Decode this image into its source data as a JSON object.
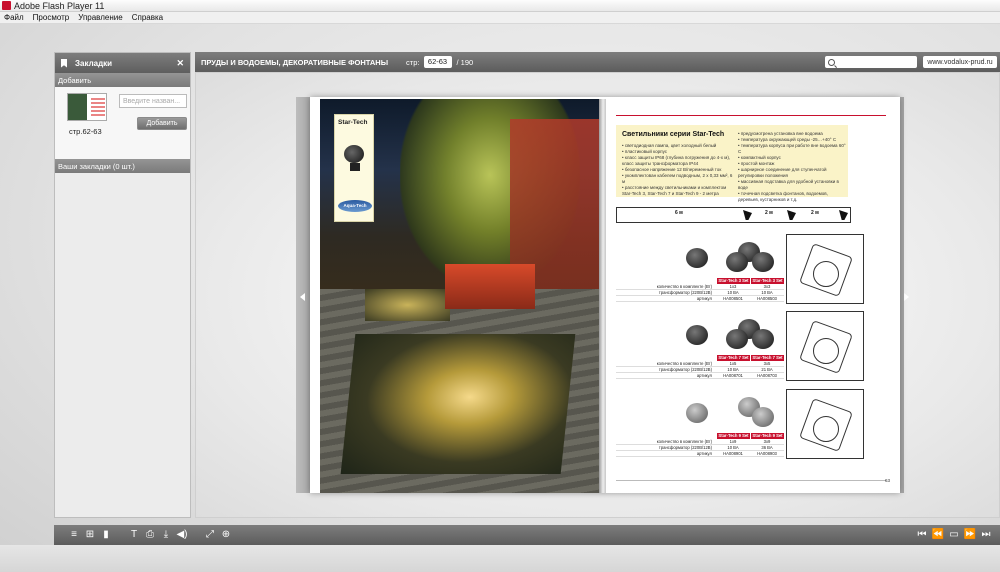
{
  "window": {
    "title": "Adobe Flash Player 11"
  },
  "menu": {
    "items": [
      "Файл",
      "Просмотр",
      "Управление",
      "Справка"
    ]
  },
  "bookmarks": {
    "header": "Закладки",
    "add_section": "Добавить",
    "thumb_label": "стр.62-63",
    "name_placeholder": "Введите назван...",
    "add_button": "Добавить",
    "list_header": "Ваши закладки (0 шт.)"
  },
  "toolbar": {
    "doc_title": "ПРУДЫ И ВОДОЕМЫ, ДЕКОРАТИВНЫЕ ФОНТАНЫ",
    "page_label": "стр:",
    "page_value": "62-63",
    "page_total": "/ 190",
    "site": "www.vodalux-prud.ru"
  },
  "book": {
    "left": {
      "product_title": "Star-Tech",
      "brand": "Aqua-Tech"
    },
    "right": {
      "info_title": "Светильники серии Star-Tech",
      "features_left": [
        "светодиодная лампа, цвет холодный белый",
        "пластиковый корпус",
        "класс защиты IP68 (глубина погружения до 4-х м), класс защиты трансформатора IP44",
        "безопасное напряжение 12 В/переменный ток",
        "укомплектован кабелем подводным, 2 х 0,33 мм², 6 м",
        "расстояние между светильниками и комплектом Star-Tech 3, Star-Tech 7 и Star-Tech 9 - 2 метра"
      ],
      "features_right": [
        "предусмотрена установка вне водоема",
        "температура окружающей среды -25…+40° С",
        "температура корпуса при работе вне водоема 60° С",
        "компактный корпус",
        "простой монтаж",
        "шарнирное соединение для ступенчатой регулировки положения",
        "массивная подставка для удобной установки в воде",
        "точечная подсветка фонтанов, водоемов, деревьев, кустарников и т.д."
      ],
      "cable_labels": [
        "6 м",
        "2 м",
        "2 м"
      ],
      "products": [
        {
          "headers": [
            "Star-Tech 3 Set 1",
            "Star-Tech 3 Set 3"
          ],
          "rows": [
            {
              "k": "количество в комплекте (Вт)",
              "v": [
                "1x3",
                "3x3"
              ]
            },
            {
              "k": "трансформатор (220В/12В)",
              "v": [
                "10 ВА",
                "10 ВА"
              ]
            },
            {
              "k": "артикул",
              "v": [
                "HA008501",
                "HA008503"
              ]
            }
          ]
        },
        {
          "headers": [
            "Star-Tech 7 Set 1",
            "Star-Tech 7 Set 3"
          ],
          "rows": [
            {
              "k": "количество в комплекте (Вт)",
              "v": [
                "1x5",
                "3x5"
              ]
            },
            {
              "k": "трансформатор (220В/12В)",
              "v": [
                "10 ВА",
                "21 ВА"
              ]
            },
            {
              "k": "артикул",
              "v": [
                "HA008701",
                "HA008703"
              ]
            }
          ]
        },
        {
          "headers": [
            "Star-Tech 9 Set 1",
            "Star-Tech 9 Set 3"
          ],
          "rows": [
            {
              "k": "количество в комплекте (Вт)",
              "v": [
                "1x9",
                "3x9"
              ]
            },
            {
              "k": "трансформатор (220В/12В)",
              "v": [
                "10 ВА",
                "36 ВА"
              ]
            },
            {
              "k": "артикул",
              "v": [
                "HA008901",
                "HA008903"
              ]
            }
          ]
        }
      ],
      "page_number": "63"
    }
  },
  "bottom_toolbar": {
    "left_icons": [
      "≡",
      "⊞",
      "▮",
      "T",
      "⎙",
      "⤓",
      "◀)",
      "⤢",
      "⊕"
    ],
    "right_icons": [
      "⏮",
      "⏪",
      "▭",
      "⏩",
      "⏭"
    ]
  }
}
